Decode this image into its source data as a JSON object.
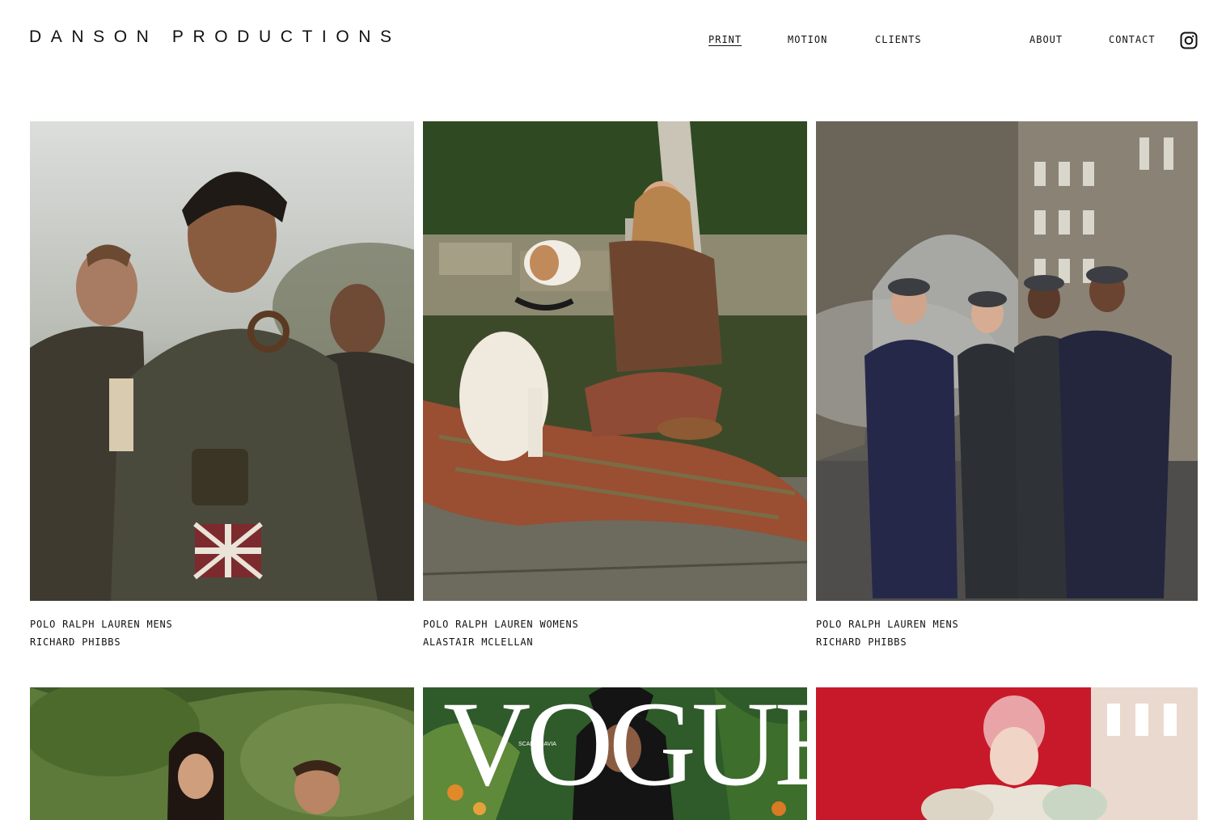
{
  "header": {
    "logo": "DANSON PRODUCTIONS",
    "nav": [
      {
        "label": "PRINT",
        "active": true
      },
      {
        "label": "MOTION",
        "active": false
      },
      {
        "label": "CLIENTS",
        "active": false
      },
      {
        "label": "ABOUT",
        "active": false
      },
      {
        "label": "CONTACT",
        "active": false
      }
    ],
    "instagram_icon": "instagram-icon"
  },
  "gallery": [
    {
      "brand": "POLO RALPH LAUREN MENS",
      "photographer": "RICHARD PHIBBS"
    },
    {
      "brand": "POLO RALPH LAUREN WOMENS",
      "photographer": "ALASTAIR MCLELLAN"
    },
    {
      "brand": "POLO RALPH LAUREN MENS",
      "photographer": "RICHARD PHIBBS"
    },
    {
      "brand": "",
      "photographer": ""
    },
    {
      "brand": "",
      "photographer": ""
    },
    {
      "brand": "",
      "photographer": ""
    }
  ],
  "covers": {
    "vogue_masthead": "VOGUE",
    "vogue_edition": "SCANDINAVIA"
  }
}
